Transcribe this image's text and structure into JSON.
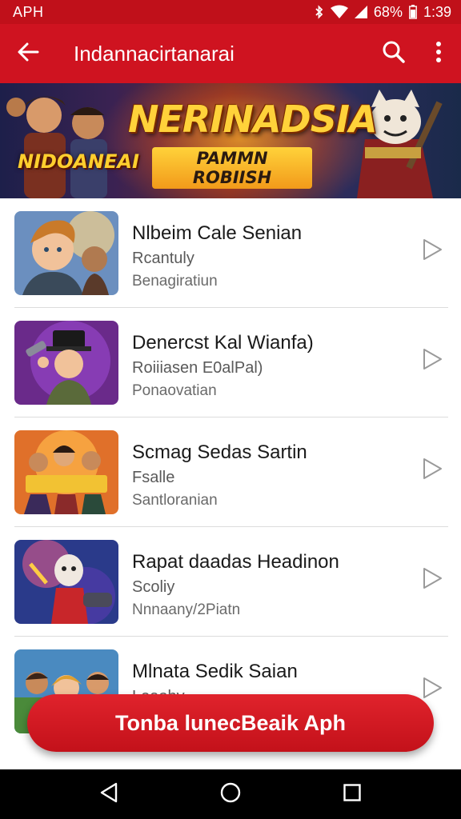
{
  "status_bar": {
    "carrier": "APH",
    "battery_percent": "68%",
    "time": "1:39"
  },
  "app_bar": {
    "title": "Indannacirtanarai",
    "icons": [
      "back-arrow-icon",
      "search-icon",
      "more-vert-icon"
    ]
  },
  "banner": {
    "title": "NERINADSIA",
    "subtitle": "PAMMN ROBIISH",
    "badge": "NIDOANEAI"
  },
  "items": [
    {
      "title": "Nlbeim Cale Senian",
      "subtitle": "Rcantuly",
      "meta": "Benagiratiun"
    },
    {
      "title": "Denercst Kal Wianfa)",
      "subtitle": "Roiiiasen E0alPal)",
      "meta": "Ponaovatian"
    },
    {
      "title": "Scmag Sedas Sartin",
      "subtitle": "Fsalle",
      "meta": "Santloranian"
    },
    {
      "title": "Rapat daadas Headinon",
      "subtitle": "Scoliy",
      "meta": "Nnnaany/2Piatn"
    },
    {
      "title": "Mlnata Sedik Saian",
      "subtitle": "Leaohy",
      "meta": ""
    }
  ],
  "cta": {
    "label": "Tonba lunecBeaik Aph"
  },
  "colors": {
    "primary": "#cf1320",
    "status": "#c0101a"
  },
  "nav": {
    "icons": [
      "back-triangle-icon",
      "home-circle-icon",
      "recents-square-icon"
    ]
  }
}
